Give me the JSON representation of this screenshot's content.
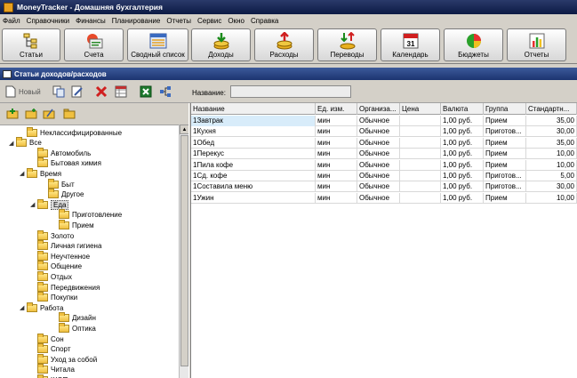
{
  "window": {
    "title": "MoneyTracker - Домашняя бухгалтерия"
  },
  "menu": [
    "Файл",
    "Справочники",
    "Финансы",
    "Планирование",
    "Отчеты",
    "Сервис",
    "Окно",
    "Справка"
  ],
  "toolbar": {
    "buttons": [
      {
        "label": "Статьи",
        "icon": "articles-tree-icon"
      },
      {
        "label": "Счета",
        "icon": "accounts-icon"
      },
      {
        "label": "Сводный список",
        "icon": "summary-list-icon"
      },
      {
        "label": "Доходы",
        "icon": "income-icon"
      },
      {
        "label": "Расходы",
        "icon": "expenses-icon"
      },
      {
        "label": "Переводы",
        "icon": "transfers-icon"
      },
      {
        "label": "Календарь",
        "icon": "calendar-icon",
        "day": "31"
      },
      {
        "label": "Бюджеты",
        "icon": "budget-pie-icon"
      },
      {
        "label": "Отчеты",
        "icon": "reports-chart-icon"
      }
    ]
  },
  "subwindow": {
    "title": "Статьи доходов/расходов"
  },
  "toolbar2": {
    "new_label": "Новый",
    "name_label": "Название:",
    "name_value": ""
  },
  "tree": {
    "items": [
      {
        "label": "Неклассифицированные",
        "level": 1,
        "expander": ""
      },
      {
        "label": "Все",
        "level": 0,
        "expander": "◢"
      },
      {
        "label": "Автомобиль",
        "level": 2,
        "expander": ""
      },
      {
        "label": "Бытовая химия",
        "level": 2,
        "expander": ""
      },
      {
        "label": "Время",
        "level": 1,
        "expander": "◢"
      },
      {
        "label": "Быт",
        "level": 3,
        "expander": ""
      },
      {
        "label": "Другое",
        "level": 3,
        "expander": ""
      },
      {
        "label": "Еда",
        "level": 2,
        "expander": "◢",
        "selected": true
      },
      {
        "label": "Приготовление",
        "level": 4,
        "expander": ""
      },
      {
        "label": "Прием",
        "level": 4,
        "expander": ""
      },
      {
        "label": "Золото",
        "level": 2,
        "expander": ""
      },
      {
        "label": "Личная гигиена",
        "level": 2,
        "expander": ""
      },
      {
        "label": "Неучтенное",
        "level": 2,
        "expander": ""
      },
      {
        "label": "Общение",
        "level": 2,
        "expander": ""
      },
      {
        "label": "Отдых",
        "level": 2,
        "expander": ""
      },
      {
        "label": "Передвижения",
        "level": 2,
        "expander": ""
      },
      {
        "label": "Покупки",
        "level": 2,
        "expander": ""
      },
      {
        "label": "Работа",
        "level": 1,
        "expander": "◢"
      },
      {
        "label": "Дизайн",
        "level": 4,
        "expander": ""
      },
      {
        "label": "Оптика",
        "level": 4,
        "expander": ""
      },
      {
        "label": "Сон",
        "level": 2,
        "expander": ""
      },
      {
        "label": "Спорт",
        "level": 2,
        "expander": ""
      },
      {
        "label": "Уход за собой",
        "level": 2,
        "expander": ""
      },
      {
        "label": "Читала",
        "level": 2,
        "expander": ""
      },
      {
        "label": "ШОП",
        "level": 2,
        "expander": ""
      }
    ]
  },
  "grid": {
    "columns": [
      "Название",
      "Ед. изм.",
      "Организа...",
      "Цена",
      "Валюта",
      "Группа",
      "Стандартн..."
    ],
    "rows": [
      [
        "1Завтрак",
        "мин",
        "Обычное",
        "",
        "1,00 руб.",
        "Прием",
        "35,00"
      ],
      [
        "1Кухня",
        "мин",
        "Обычное",
        "",
        "1,00 руб.",
        "Приготов...",
        "30,00"
      ],
      [
        "1Обед",
        "мин",
        "Обычное",
        "",
        "1,00 руб.",
        "Прием",
        "35,00"
      ],
      [
        "1Перекус",
        "мин",
        "Обычное",
        "",
        "1,00 руб.",
        "Прием",
        "10,00"
      ],
      [
        "1Пила кофе",
        "мин",
        "Обычное",
        "",
        "1,00 руб.",
        "Прием",
        "10,00"
      ],
      [
        "1Сд. кофе",
        "мин",
        "Обычное",
        "",
        "1,00 руб.",
        "Приготов...",
        "5,00"
      ],
      [
        "1Составила меню",
        "мин",
        "Обычное",
        "",
        "1,00 руб.",
        "Приготов...",
        "30,00"
      ],
      [
        "1Ужин",
        "мин",
        "Обычное",
        "",
        "1,00 руб.",
        "Прием",
        "10,00"
      ]
    ]
  },
  "colors": {
    "title_bar": "#0c1a44",
    "selection": "#d8ecfa",
    "folder": "#f0c040"
  }
}
